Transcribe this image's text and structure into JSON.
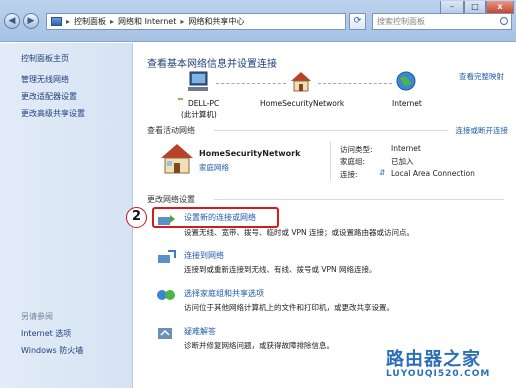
{
  "window": {
    "breadcrumb": [
      "控制面板",
      "网络和 Internet",
      "网络和共享中心"
    ],
    "search_placeholder": "搜索控制面板",
    "close_glyph": "x"
  },
  "sidebar": {
    "home": "控制面板主页",
    "items": [
      "管理无线网络",
      "更改适配器设置",
      "更改高级共享设置"
    ],
    "see_also_title": "另请参阅",
    "see_also": [
      "Internet 选项",
      "Windows 防火墙"
    ]
  },
  "main": {
    "heading": "查看基本网络信息并设置连接",
    "view_full_map": "查看完整映射",
    "map": {
      "computer": "DELL-PC",
      "computer_sub": "(此计算机)",
      "network": "HomeSecurityNetwork",
      "internet": "Internet"
    },
    "active": {
      "label": "查看活动网络",
      "connect_link": "连接或断开连接",
      "name": "HomeSecurityNetwork",
      "type": "家庭网络",
      "access_type_label": "访问类型:",
      "access_type_value": "Internet",
      "homegroup_label": "家庭组:",
      "homegroup_value": "已加入",
      "connection_label": "连接:",
      "connection_value": "Local Area Connection"
    },
    "change_label": "更改网络设置",
    "tasks": [
      {
        "title": "设置新的连接或网络",
        "desc": "设置无线、宽带、拨号、临时或 VPN 连接；或设置路由器或访问点。"
      },
      {
        "title": "连接到网络",
        "desc": "连接到或重新连接到无线、有线、拨号或 VPN 网络连接。"
      },
      {
        "title": "选择家庭组和共享选项",
        "desc": "访问位于其他网络计算机上的文件和打印机，或更改共享设置。"
      },
      {
        "title": "疑难解答",
        "desc": "诊断并修复网络问题，或获得故障排除信息。"
      }
    ]
  },
  "annotation": {
    "number": "2"
  },
  "watermark": {
    "line1": "路由器之家",
    "line2": "LUYOUQI520.COM"
  }
}
